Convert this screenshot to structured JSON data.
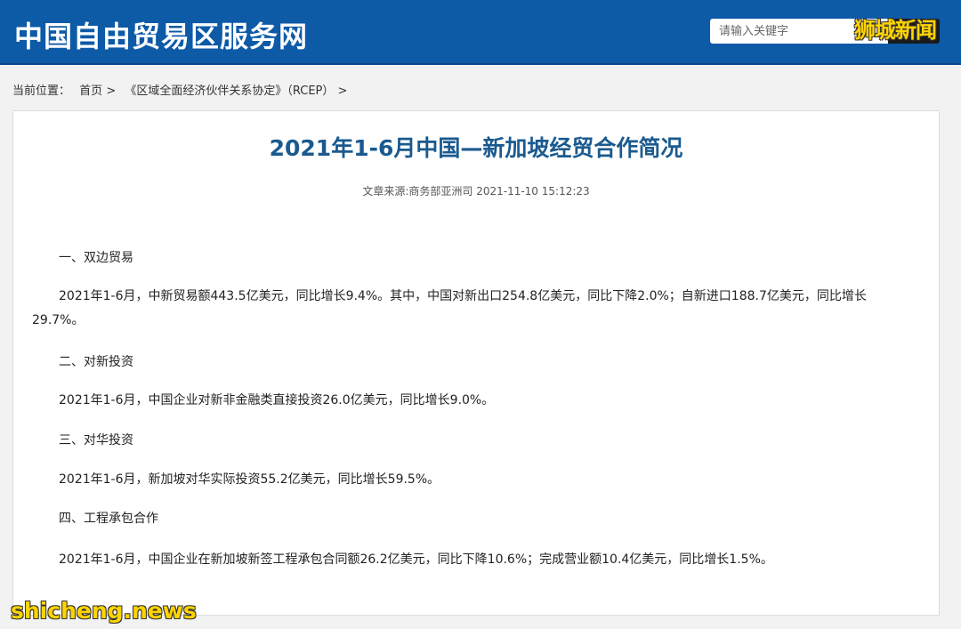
{
  "header": {
    "site_title": "中国自由贸易区服务网",
    "search_placeholder": "请输入关键字",
    "search_button_label": ""
  },
  "breadcrumb": {
    "label": "当前位置：",
    "items": [
      "首页",
      "《区域全面经济伙伴关系协定》（RCEP）"
    ],
    "separator": ">"
  },
  "article": {
    "title": "2021年1-6月中国—新加坡经贸合作简况",
    "meta": "文章来源:商务部亚洲司 2021-11-10 15:12:23",
    "sections": [
      {
        "heading": "一、双边贸易",
        "body": "2021年1-6月，中新贸易额443.5亿美元，同比增长9.4%。其中，中国对新出口254.8亿美元，同比下降2.0%；自新进口188.7亿美元，同比增长29.7%。"
      },
      {
        "heading": "二、对新投资",
        "body": "2021年1-6月，中国企业对新非金融类直接投资26.0亿美元，同比增长9.0%。"
      },
      {
        "heading": "三、对华投资",
        "body": "2021年1-6月，新加坡对华实际投资55.2亿美元，同比增长59.5%。"
      },
      {
        "heading": "四、工程承包合作",
        "body": "2021年1-6月，中国企业在新加坡新签工程承包合同额26.2亿美元，同比下降10.6%；完成营业额10.4亿美元，同比增长1.5%。"
      }
    ]
  },
  "watermarks": {
    "top": "狮城新闻",
    "bottom": "shicheng.news"
  },
  "colors": {
    "header_bg": "#0d5aa7",
    "title": "#1a5a8f",
    "watermark": "#ffd400"
  }
}
